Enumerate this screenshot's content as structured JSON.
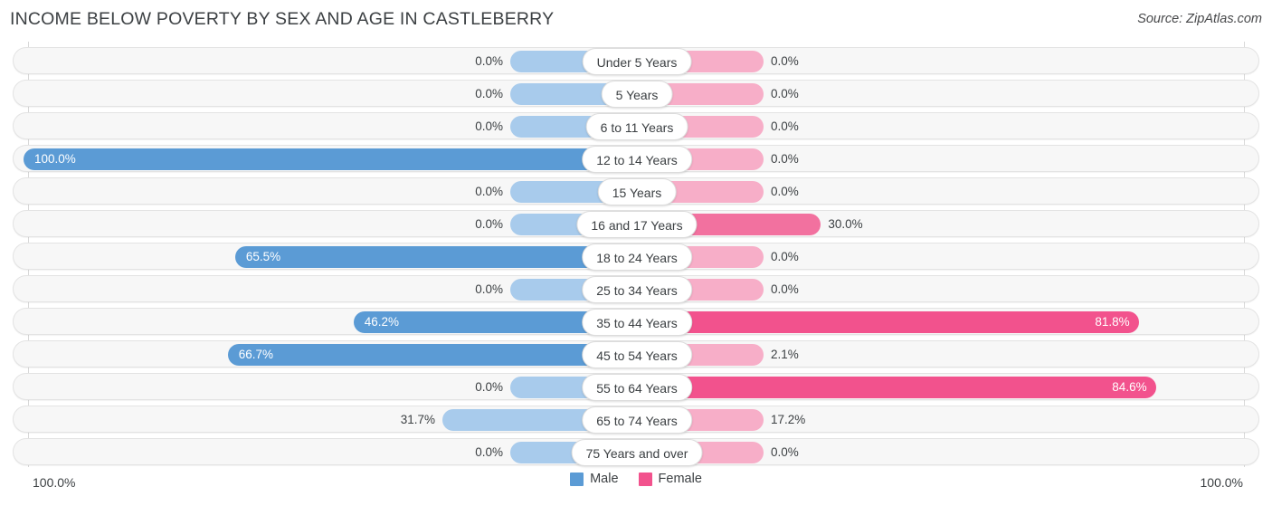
{
  "header": {
    "title": "INCOME BELOW POVERTY BY SEX AND AGE IN CASTLEBERRY",
    "source": "Source: ZipAtlas.com"
  },
  "footer": {
    "axis_min_left": "100.0%",
    "axis_max_right": "100.0%",
    "legend": [
      {
        "label": "Male",
        "color": "#5b9bd5"
      },
      {
        "label": "Female",
        "color": "#f2528d"
      }
    ]
  },
  "colors": {
    "male_strong": "#5b9bd5",
    "male_pale": "#a8cbec",
    "female_strong": "#f2528d",
    "female_mid": "#f2719f",
    "female_pale": "#f7aec8",
    "track": "#f7f7f7",
    "track_border": "#e3e3e3",
    "axis": "#d9d9d9"
  },
  "chart_data": {
    "type": "bar",
    "orientation": "horizontal",
    "style": "diverging-bidirectional",
    "title": "INCOME BELOW POVERTY BY SEX AND AGE IN CASTLEBERRY",
    "xlabel": "",
    "ylabel": "",
    "xlim": [
      100,
      100
    ],
    "unit": "%",
    "grid": false,
    "legend_position": "bottom-center",
    "axis_tick_labels": [
      "100.0%",
      "100.0%"
    ],
    "categories": [
      "Under 5 Years",
      "5 Years",
      "6 to 11 Years",
      "12 to 14 Years",
      "15 Years",
      "16 and 17 Years",
      "18 to 24 Years",
      "25 to 34 Years",
      "35 to 44 Years",
      "45 to 54 Years",
      "55 to 64 Years",
      "65 to 74 Years",
      "75 Years and over"
    ],
    "series": [
      {
        "name": "Male",
        "side": "left",
        "values": [
          0.0,
          0.0,
          0.0,
          100.0,
          0.0,
          0.0,
          65.5,
          0.0,
          46.2,
          66.7,
          0.0,
          31.7,
          0.0
        ],
        "labels": [
          "0.0%",
          "0.0%",
          "0.0%",
          "100.0%",
          "0.0%",
          "0.0%",
          "65.5%",
          "0.0%",
          "46.2%",
          "66.7%",
          "0.0%",
          "31.7%",
          "0.0%"
        ]
      },
      {
        "name": "Female",
        "side": "right",
        "values": [
          0.0,
          0.0,
          0.0,
          0.0,
          0.0,
          30.0,
          0.0,
          0.0,
          81.8,
          2.1,
          84.6,
          17.2,
          0.0
        ],
        "labels": [
          "0.0%",
          "0.0%",
          "0.0%",
          "0.0%",
          "0.0%",
          "30.0%",
          "0.0%",
          "0.0%",
          "81.8%",
          "2.1%",
          "84.6%",
          "17.2%",
          "0.0%"
        ]
      }
    ]
  }
}
